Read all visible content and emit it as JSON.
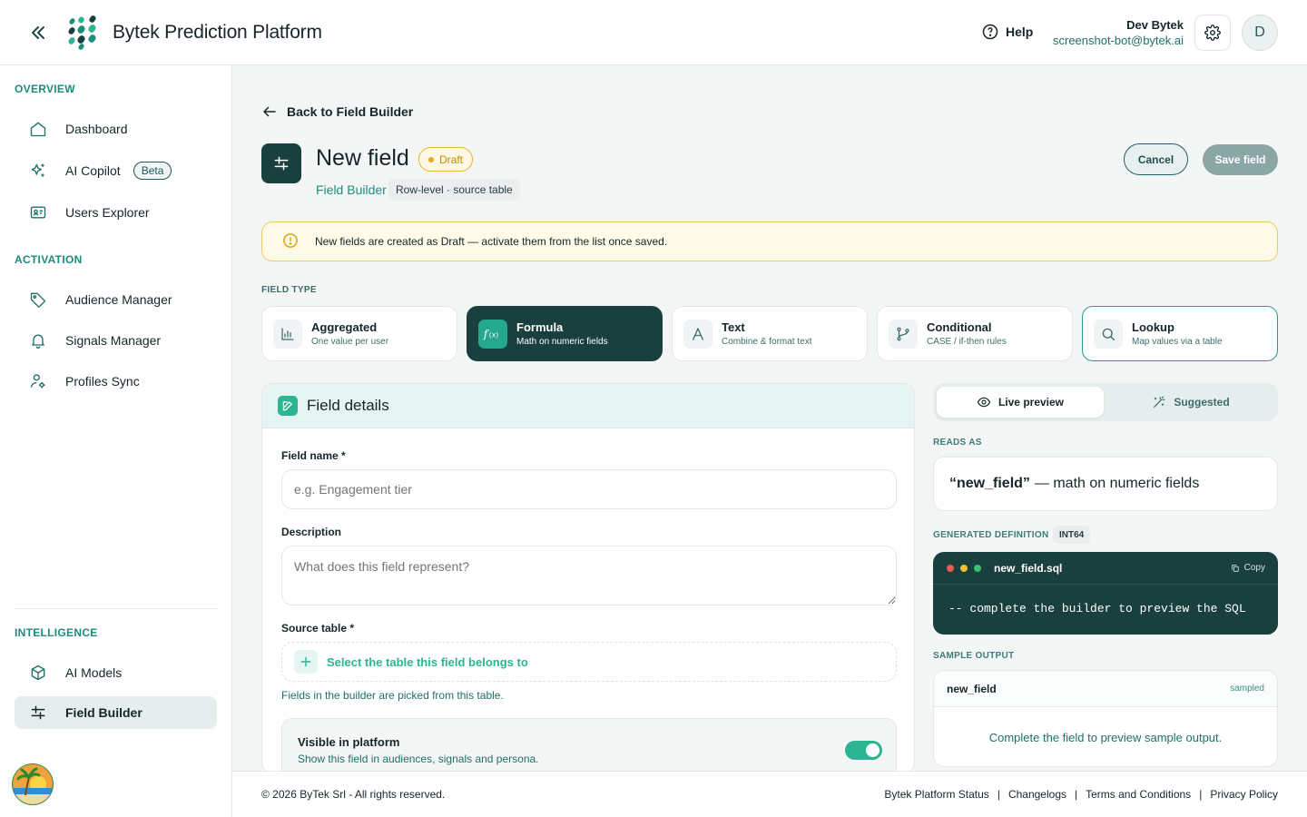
{
  "header": {
    "title": "Bytek Prediction Platform",
    "help": "Help",
    "user_name": "Dev Bytek",
    "user_email": "screenshot-bot@bytek.ai",
    "avatar_initial": "D"
  },
  "sidebar": {
    "sections": {
      "overview": "OVERVIEW",
      "activation": "ACTIVATION",
      "intelligence": "INTELLIGENCE"
    },
    "items": [
      {
        "label": "Dashboard",
        "icon": "home-icon"
      },
      {
        "label": "AI Copilot",
        "icon": "sparkles-icon",
        "badge": "Beta"
      },
      {
        "label": "Users Explorer",
        "icon": "id-card-icon"
      },
      {
        "label": "Audience Manager",
        "icon": "tag-icon"
      },
      {
        "label": "Signals Manager",
        "icon": "bell-icon"
      },
      {
        "label": "Profiles Sync",
        "icon": "user-gear-icon"
      },
      {
        "label": "AI Models",
        "icon": "cube-icon"
      },
      {
        "label": "Field Builder",
        "icon": "sliders-icon",
        "active": true
      }
    ]
  },
  "page": {
    "back": "Back to Field Builder",
    "title": "New field",
    "status": "Draft",
    "crumb": "Field Builder",
    "crumb_chip": "Row-level · source table",
    "cancel": "Cancel",
    "save": "Save field",
    "banner": "New fields are created as Draft — activate them from the list once saved."
  },
  "field_type": {
    "label": "FIELD TYPE",
    "options": [
      {
        "title": "Aggregated",
        "subtitle": "One value per user",
        "icon": "bar-chart-icon"
      },
      {
        "title": "Formula",
        "subtitle": "Math on numeric fields",
        "icon": "function-icon",
        "selected": true
      },
      {
        "title": "Text",
        "subtitle": "Combine & format text",
        "icon": "text-icon"
      },
      {
        "title": "Conditional",
        "subtitle": "CASE / if-then rules",
        "icon": "branch-icon"
      },
      {
        "title": "Lookup",
        "subtitle": "Map values via a table",
        "icon": "search-icon"
      }
    ]
  },
  "details": {
    "title": "Field details",
    "name_label": "Field name *",
    "name_placeholder": "e.g. Engagement tier",
    "desc_label": "Description",
    "desc_placeholder": "What does this field represent?",
    "source_label": "Source table *",
    "source_action": "Select the table this field belongs to",
    "source_hint": "Fields in the builder are picked from this table.",
    "visible_title": "Visible in platform",
    "visible_desc": "Show this field in audiences, signals and persona.",
    "visible_on": true
  },
  "preview": {
    "tab_live": "Live preview",
    "tab_suggested": "Suggested",
    "reads_as_label": "READS AS",
    "reads_name": "“new_field”",
    "reads_desc": "— math on numeric fields",
    "gen_label": "GENERATED DEFINITION",
    "gen_type": "INT64",
    "file": "new_field.sql",
    "copy": "Copy",
    "code": "-- complete the builder to preview the SQL",
    "sample_label": "SAMPLE OUTPUT",
    "sample_col": "new_field",
    "sample_tag": "sampled",
    "sample_empty": "Complete the field to preview sample output."
  },
  "footer": {
    "copyright": "© 2026 ByTek Srl - All rights reserved.",
    "links": [
      "Bytek Platform Status",
      "Changelogs",
      "Terms and Conditions",
      "Privacy Policy"
    ]
  },
  "colors": {
    "primary_dark": "#19403f",
    "accent": "#2bb592",
    "warning": "#e9b42e"
  }
}
